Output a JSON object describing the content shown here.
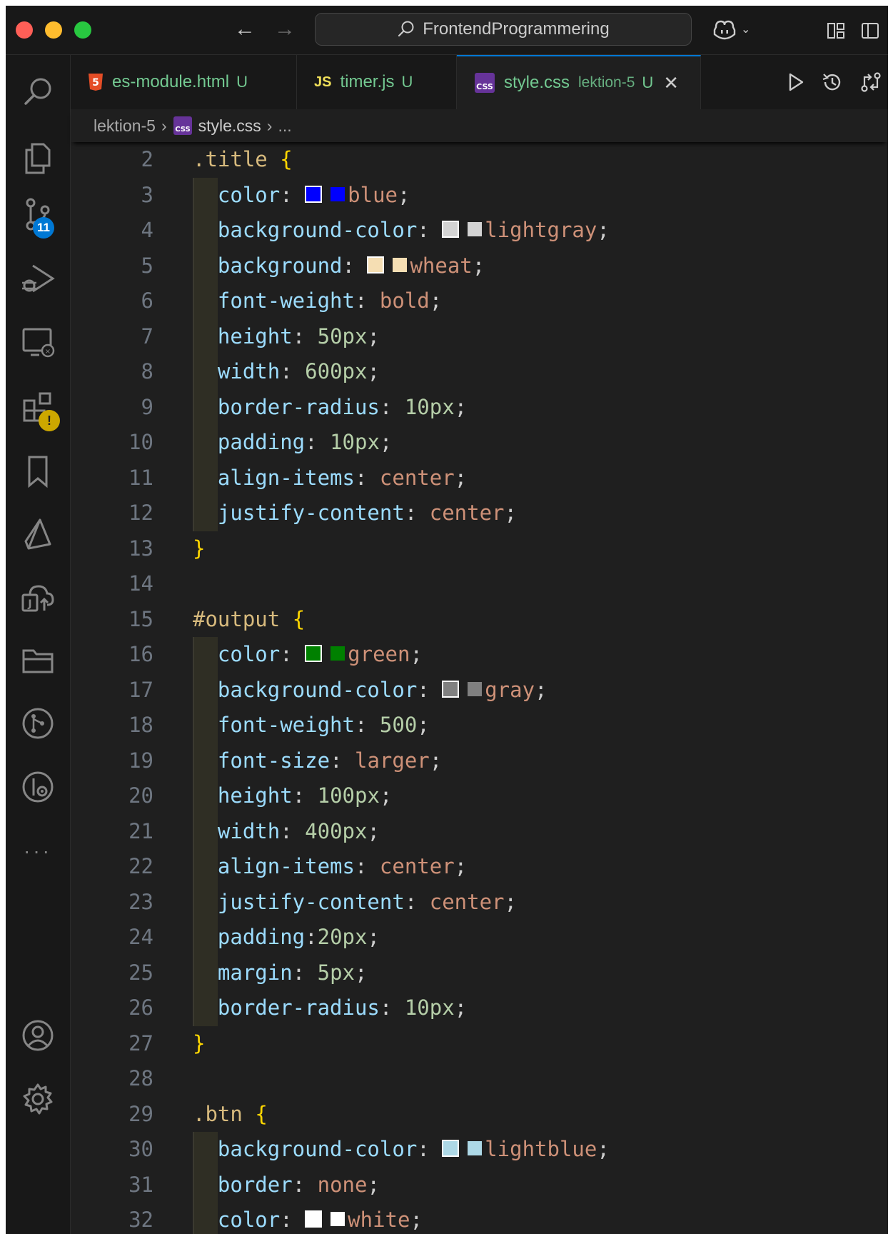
{
  "titlebar": {
    "search_text": "FrontendProgrammering"
  },
  "activity": {
    "scm_badge": "11"
  },
  "tabs": [
    {
      "label": "es-module.html",
      "status": "U",
      "icon": "html-file-icon"
    },
    {
      "label": "timer.js",
      "status": "U",
      "icon": "js-file-icon"
    },
    {
      "label": "style.css",
      "desc": "lektion-5",
      "status": "U",
      "icon": "css-file-icon",
      "active": true
    }
  ],
  "breadcrumb": {
    "folder": "lektion-5",
    "file": "style.css",
    "more": "..."
  },
  "editor": {
    "lines": [
      {
        "n": "2",
        "kind": "sel",
        "sel": ".title",
        "brace": "{"
      },
      {
        "n": "3",
        "kind": "decl",
        "prop": "color",
        "val": "blue",
        "swatch": "#0000ff"
      },
      {
        "n": "4",
        "kind": "decl",
        "prop": "background-color",
        "val": "lightgray",
        "swatch": "#d3d3d3"
      },
      {
        "n": "5",
        "kind": "decl",
        "prop": "background",
        "val": "wheat",
        "swatch": "#f5deb3"
      },
      {
        "n": "6",
        "kind": "decl",
        "prop": "font-weight",
        "val": "bold"
      },
      {
        "n": "7",
        "kind": "decl",
        "prop": "height",
        "val": "50px",
        "numeric": true
      },
      {
        "n": "8",
        "kind": "decl",
        "prop": "width",
        "val": "600px",
        "numeric": true
      },
      {
        "n": "9",
        "kind": "decl",
        "prop": "border-radius",
        "val": "10px",
        "numeric": true
      },
      {
        "n": "10",
        "kind": "decl",
        "prop": "padding",
        "val": "10px",
        "numeric": true
      },
      {
        "n": "11",
        "kind": "decl",
        "prop": "align-items",
        "val": "center"
      },
      {
        "n": "12",
        "kind": "decl",
        "prop": "justify-content",
        "val": "center"
      },
      {
        "n": "13",
        "kind": "close",
        "brace": "}"
      },
      {
        "n": "14",
        "kind": "blank"
      },
      {
        "n": "15",
        "kind": "sel",
        "sel": "#output",
        "brace": "{"
      },
      {
        "n": "16",
        "kind": "decl",
        "prop": "color",
        "val": "green",
        "swatch": "#008000"
      },
      {
        "n": "17",
        "kind": "decl",
        "prop": "background-color",
        "val": "gray",
        "swatch": "#808080"
      },
      {
        "n": "18",
        "kind": "decl",
        "prop": "font-weight",
        "val": "500",
        "numeric": true
      },
      {
        "n": "19",
        "kind": "decl",
        "prop": "font-size",
        "val": "larger"
      },
      {
        "n": "20",
        "kind": "decl",
        "prop": "height",
        "val": "100px",
        "numeric": true
      },
      {
        "n": "21",
        "kind": "decl",
        "prop": "width",
        "val": "400px",
        "numeric": true
      },
      {
        "n": "22",
        "kind": "decl",
        "prop": "align-items",
        "val": "center"
      },
      {
        "n": "23",
        "kind": "decl",
        "prop": "justify-content",
        "val": "center"
      },
      {
        "n": "24",
        "kind": "decl",
        "prop": "padding",
        "val": "20px",
        "numeric": true,
        "nospace": true
      },
      {
        "n": "25",
        "kind": "decl",
        "prop": "margin",
        "val": "5px",
        "numeric": true
      },
      {
        "n": "26",
        "kind": "decl",
        "prop": "border-radius",
        "val": "10px",
        "numeric": true
      },
      {
        "n": "27",
        "kind": "close",
        "brace": "}"
      },
      {
        "n": "28",
        "kind": "blank"
      },
      {
        "n": "29",
        "kind": "sel",
        "sel": ".btn",
        "brace": "{"
      },
      {
        "n": "30",
        "kind": "decl",
        "prop": "background-color",
        "val": "lightblue",
        "swatch": "#add8e6"
      },
      {
        "n": "31",
        "kind": "decl",
        "prop": "border",
        "val": "none"
      },
      {
        "n": "32",
        "kind": "decl",
        "prop": "color",
        "val": "white",
        "swatch": "#ffffff"
      }
    ]
  }
}
